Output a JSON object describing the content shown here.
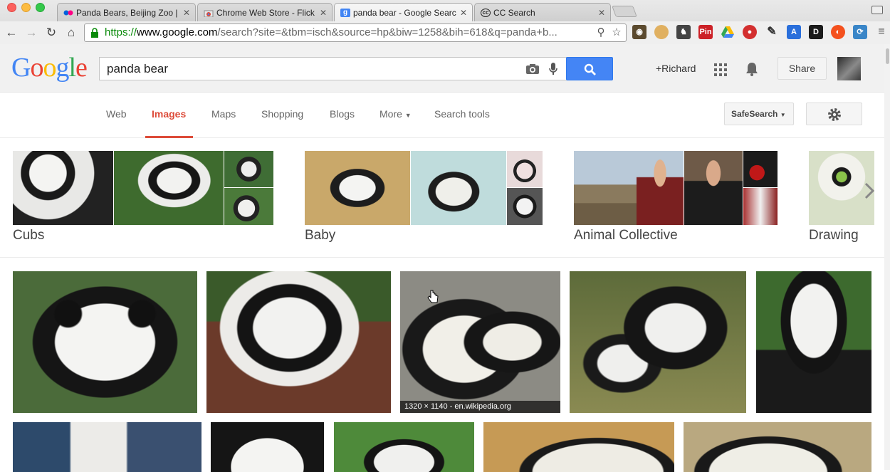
{
  "browser": {
    "tabs": [
      {
        "title": "Panda Bears, Beijing Zoo |",
        "favicon": "flickr-icon"
      },
      {
        "title": "Chrome Web Store - Flick",
        "favicon": "chrome-store-icon"
      },
      {
        "title": "panda bear - Google Searc",
        "favicon": "google-icon",
        "active": true
      },
      {
        "title": "CC Search",
        "favicon": "cc-icon"
      }
    ],
    "url_scheme": "https://",
    "url_host": "www.google.com",
    "url_path": "/search?site=&tbm=isch&source=hp&biw=1258&bih=618&q=panda+b...",
    "extensions": [
      "owl-icon",
      "cookie-icon",
      "elephant-icon",
      "pinterest-icon",
      "drive-icon",
      "bug-icon",
      "pen-icon",
      "translate-icon",
      "dash-icon",
      "chrome-orange-icon",
      "refresh-icon",
      "menu-icon"
    ],
    "ext_labels": {
      "pin": "Pin",
      "dash": "D",
      "translate": "A"
    }
  },
  "google": {
    "logo": [
      "G",
      "o",
      "o",
      "g",
      "l",
      "e"
    ],
    "logo_colors": [
      "#4285f4",
      "#ea4335",
      "#fbbc05",
      "#4285f4",
      "#34a853",
      "#ea4335"
    ],
    "query": "panda bear",
    "user": "+Richard",
    "share": "Share",
    "nav": [
      "Web",
      "Images",
      "Maps",
      "Shopping",
      "Blogs",
      "More",
      "Search tools"
    ],
    "safesearch": "SafeSearch",
    "related": [
      "Cubs",
      "Baby",
      "Animal Collective",
      "Drawing"
    ],
    "hover_caption": "1320 × 1140 - en.wikipedia.org"
  },
  "colors": {
    "accent": "#dd4b39",
    "search_blue": "#4485f5"
  }
}
